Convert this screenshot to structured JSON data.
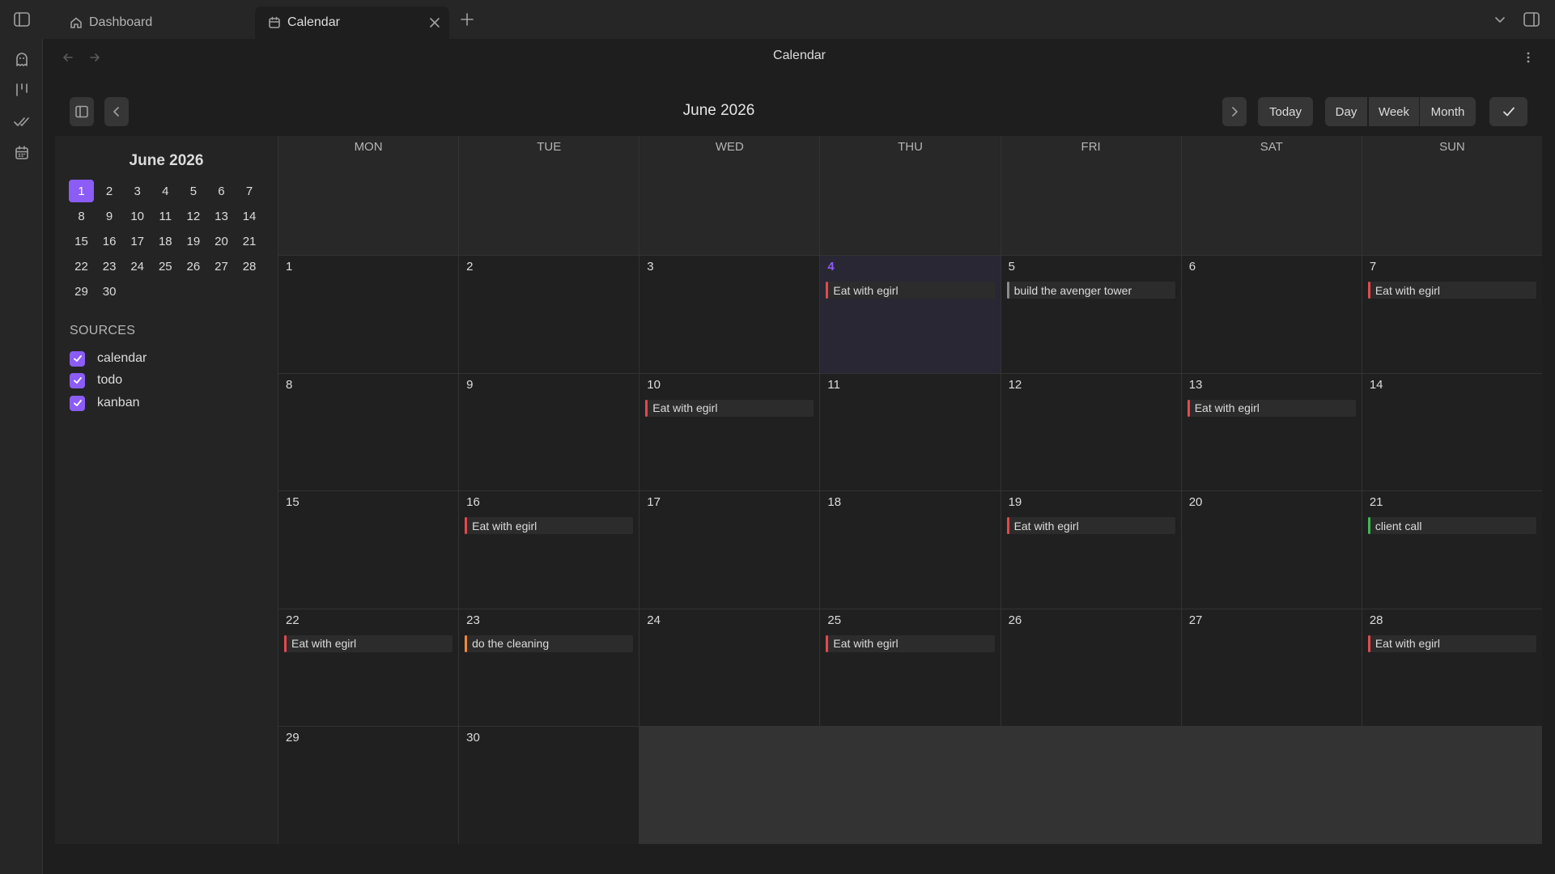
{
  "tabs": [
    {
      "label": "Dashboard"
    },
    {
      "label": "Calendar"
    }
  ],
  "view": {
    "title": "Calendar"
  },
  "toolbar": {
    "month_title": "June 2026",
    "today": "Today",
    "day": "Day",
    "week": "Week",
    "month": "Month"
  },
  "mini": {
    "title": "June 2026",
    "days": [
      "1",
      "2",
      "3",
      "4",
      "5",
      "6",
      "7",
      "8",
      "9",
      "10",
      "11",
      "12",
      "13",
      "14",
      "15",
      "16",
      "17",
      "18",
      "19",
      "20",
      "21",
      "22",
      "23",
      "24",
      "25",
      "26",
      "27",
      "28",
      "29",
      "30"
    ]
  },
  "sources": {
    "title": "SOURCES",
    "items": [
      "calendar",
      "todo",
      "kanban"
    ]
  },
  "weekdays": [
    "MON",
    "TUE",
    "WED",
    "THU",
    "FRI",
    "SAT",
    "SUN"
  ],
  "days": [
    "1",
    "2",
    "3",
    "4",
    "5",
    "6",
    "7",
    "8",
    "9",
    "10",
    "11",
    "12",
    "13",
    "14",
    "15",
    "16",
    "17",
    "18",
    "19",
    "20",
    "21",
    "22",
    "23",
    "24",
    "25",
    "26",
    "27",
    "28",
    "29",
    "30"
  ],
  "events": [
    {
      "day": "4",
      "title": "Eat with egirl",
      "color": "#e5484d"
    },
    {
      "day": "5",
      "title": "build the avenger tower",
      "color": "#8a8a8a"
    },
    {
      "day": "7",
      "title": "Eat with egirl",
      "color": "#e5484d"
    },
    {
      "day": "10",
      "title": "Eat with egirl",
      "color": "#e5484d"
    },
    {
      "day": "13",
      "title": "Eat with egirl",
      "color": "#e5484d"
    },
    {
      "day": "16",
      "title": "Eat with egirl",
      "color": "#e5484d"
    },
    {
      "day": "19",
      "title": "Eat with egirl",
      "color": "#e5484d"
    },
    {
      "day": "21",
      "title": "client call",
      "color": "#3fb950"
    },
    {
      "day": "22",
      "title": "Eat with egirl",
      "color": "#e5484d"
    },
    {
      "day": "23",
      "title": "do the cleaning",
      "color": "#f0883e"
    },
    {
      "day": "25",
      "title": "Eat with egirl",
      "color": "#e5484d"
    },
    {
      "day": "28",
      "title": "Eat with egirl",
      "color": "#e5484d"
    }
  ],
  "accent": "#8b5cf6",
  "icons": {
    "sidebar_toggle": "sidebar-icon",
    "home": "home-icon",
    "calendar": "calendar-icon",
    "close": "close-icon",
    "new_tab": "plus-icon",
    "tab_list": "chevron-down-icon",
    "right_sidebar": "right-sidebar-icon",
    "ribbon": [
      "ghost-icon",
      "kanban-icon",
      "double-check-icon",
      "calendar-icon"
    ],
    "back": "arrow-left-icon",
    "forward": "arrow-right-icon",
    "more": "more-vertical-icon",
    "prev_month": "chevron-left-icon",
    "next_month": "chevron-right-icon",
    "checkmark": "check-icon"
  }
}
